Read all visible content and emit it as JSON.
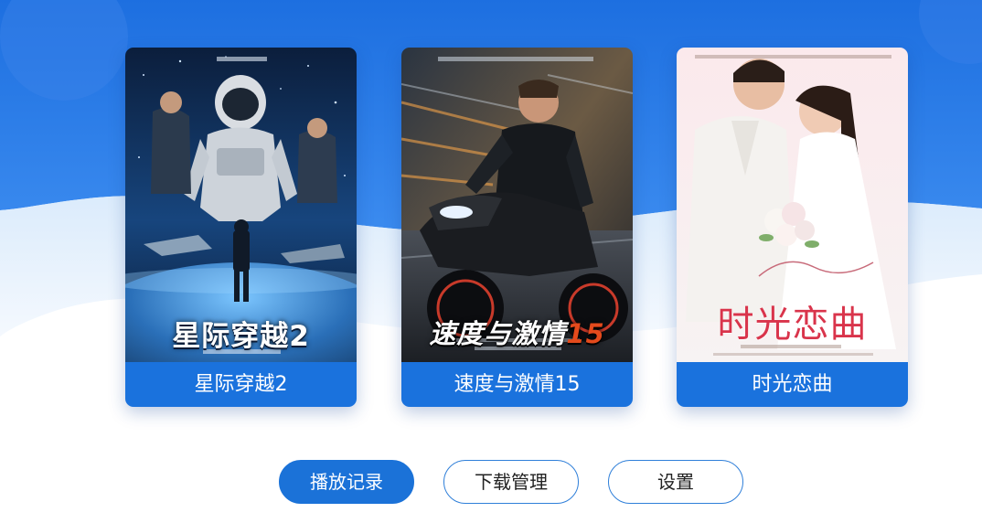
{
  "cards": [
    {
      "label": "星际穿越2",
      "poster_title_main": "星际穿越",
      "poster_title_num": "2"
    },
    {
      "label": "速度与激情15",
      "poster_title_main": "速度与激情",
      "poster_title_num": "15"
    },
    {
      "label": "时光恋曲",
      "poster_title_main": "时光恋曲",
      "poster_title_num": ""
    }
  ],
  "buttons": {
    "history": "播放记录",
    "downloads": "下载管理",
    "settings": "设置"
  },
  "colors": {
    "primary_blue": "#1b72d8",
    "background_white": "#ffffff",
    "accent_red": "#e44a1c"
  },
  "icons": []
}
